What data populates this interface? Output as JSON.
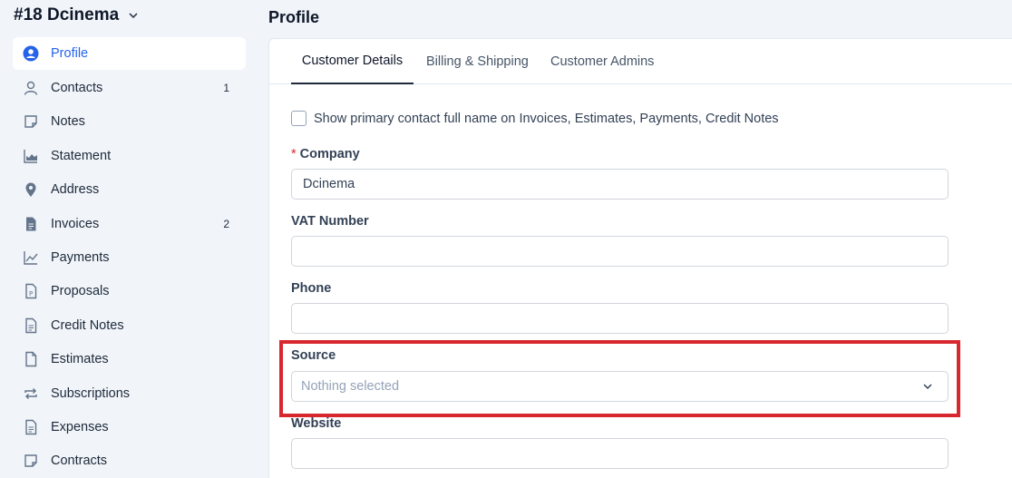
{
  "customer": {
    "title": "#18 Dcinema"
  },
  "sidebar": {
    "items": [
      {
        "label": "Profile",
        "icon": "user-circle-icon",
        "count": ""
      },
      {
        "label": "Contacts",
        "icon": "user-icon",
        "count": "1"
      },
      {
        "label": "Notes",
        "icon": "note-icon",
        "count": ""
      },
      {
        "label": "Statement",
        "icon": "area-chart-icon",
        "count": ""
      },
      {
        "label": "Address",
        "icon": "map-pin-icon",
        "count": ""
      },
      {
        "label": "Invoices",
        "icon": "invoice-icon",
        "count": "2"
      },
      {
        "label": "Payments",
        "icon": "line-chart-icon",
        "count": ""
      },
      {
        "label": "Proposals",
        "icon": "proposal-icon",
        "count": ""
      },
      {
        "label": "Credit Notes",
        "icon": "document-icon",
        "count": ""
      },
      {
        "label": "Estimates",
        "icon": "file-icon",
        "count": ""
      },
      {
        "label": "Subscriptions",
        "icon": "repeat-icon",
        "count": ""
      },
      {
        "label": "Expenses",
        "icon": "document-icon",
        "count": ""
      },
      {
        "label": "Contracts",
        "icon": "contract-icon",
        "count": ""
      }
    ]
  },
  "page": {
    "title": "Profile"
  },
  "tabs": [
    {
      "label": "Customer Details"
    },
    {
      "label": "Billing & Shipping"
    },
    {
      "label": "Customer Admins"
    }
  ],
  "form": {
    "show_contact_label": "Show primary contact full name on Invoices, Estimates, Payments, Credit Notes",
    "company": {
      "required_mark": "*",
      "label": "Company",
      "value": "Dcinema"
    },
    "vat": {
      "label": "VAT Number",
      "value": ""
    },
    "phone": {
      "label": "Phone",
      "value": ""
    },
    "source": {
      "label": "Source",
      "placeholder": "Nothing selected"
    },
    "website": {
      "label": "Website",
      "value": ""
    }
  },
  "colors": {
    "accent": "#2563eb",
    "highlight": "#d7282f",
    "required": "#dc2626"
  }
}
